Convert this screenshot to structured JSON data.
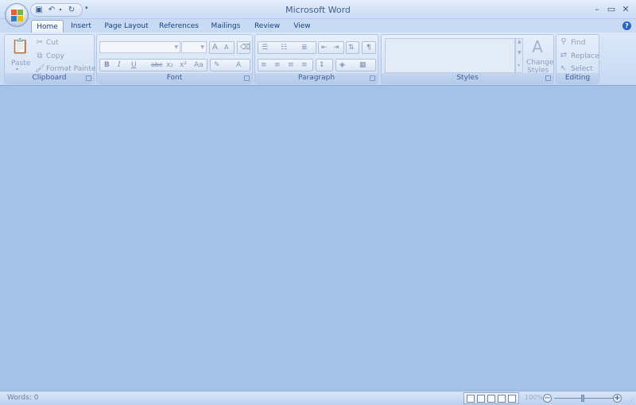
{
  "window": {
    "title": "Microsoft Word",
    "minimize": "–",
    "maximize": "▭",
    "close": "✕"
  },
  "quick_access": {
    "save_icon": "save-icon",
    "undo_icon": "undo-icon",
    "redo_icon": "redo-icon"
  },
  "tabs": [
    {
      "label": "Home",
      "active": true
    },
    {
      "label": "Insert"
    },
    {
      "label": "Page Layout"
    },
    {
      "label": "References"
    },
    {
      "label": "Mailings"
    },
    {
      "label": "Review"
    },
    {
      "label": "View"
    }
  ],
  "groups": {
    "clipboard": {
      "label": "Clipboard",
      "paste": "Paste",
      "cut": "Cut",
      "copy": "Copy",
      "format_painter": "Format Painter"
    },
    "font": {
      "label": "Font",
      "font_name": "",
      "font_size": "",
      "bold": "B",
      "italic": "I",
      "underline": "U",
      "strike": "abc",
      "subscript": "x₂",
      "superscript": "x²",
      "change_case": "Aa",
      "grow": "A",
      "shrink": "A",
      "font_color": "A"
    },
    "paragraph": {
      "label": "Paragraph",
      "show_hide": "¶"
    },
    "styles": {
      "label": "Styles",
      "change_styles_line1": "Change",
      "change_styles_line2": "Styles"
    },
    "editing": {
      "label": "Editing",
      "find": "Find",
      "replace": "Replace",
      "select": "Select"
    }
  },
  "status": {
    "words": "Words: 0",
    "zoom": "100%"
  },
  "help": "?"
}
